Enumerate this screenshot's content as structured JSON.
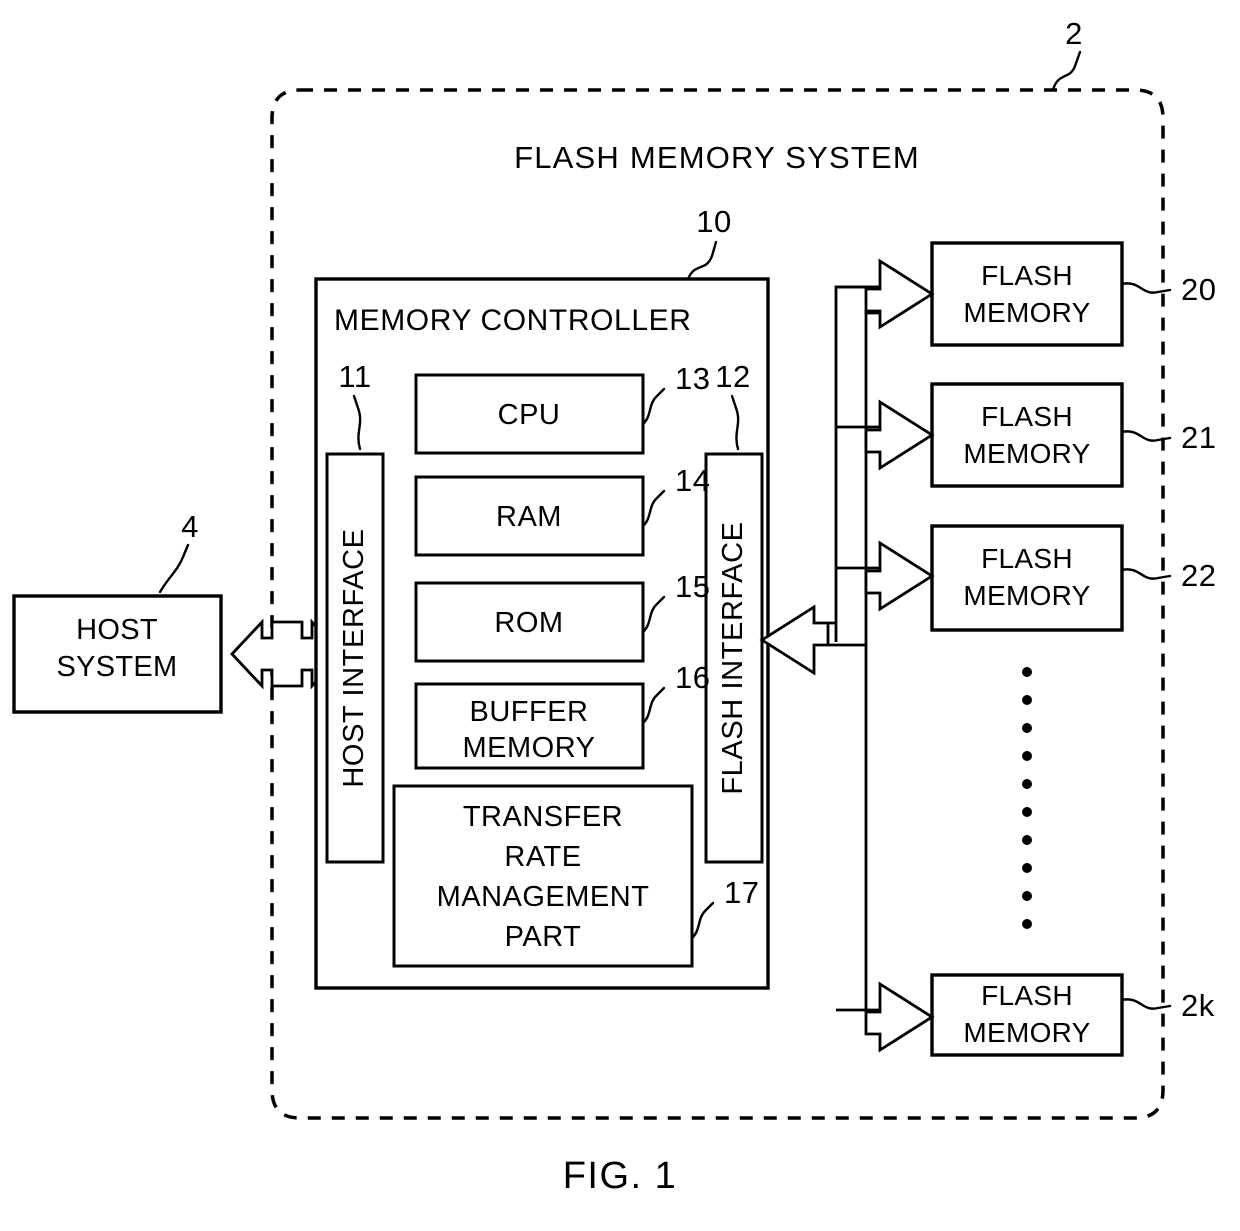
{
  "figure": {
    "caption": "FIG. 1",
    "system_title": "FLASH MEMORY SYSTEM",
    "system_ref": "2"
  },
  "host": {
    "label_line1": "HOST",
    "label_line2": "SYSTEM",
    "ref": "4"
  },
  "controller": {
    "title": "MEMORY CONTROLLER",
    "ref": "10",
    "host_interface": {
      "label": "HOST INTERFACE",
      "ref": "11"
    },
    "flash_interface": {
      "label": "FLASH INTERFACE",
      "ref": "12"
    },
    "blocks": [
      {
        "label": "CPU",
        "ref": "13"
      },
      {
        "label": "RAM",
        "ref": "14"
      },
      {
        "label": "ROM",
        "ref": "15"
      }
    ],
    "buffer": {
      "label_line1": "BUFFER",
      "label_line2": "MEMORY",
      "ref": "16"
    },
    "transfer_rate": {
      "label_line1": "TRANSFER",
      "label_line2": "RATE",
      "label_line3": "MANAGEMENT",
      "label_line4": "PART",
      "ref": "17"
    }
  },
  "flash_memories": [
    {
      "label_line1": "FLASH",
      "label_line2": "MEMORY",
      "ref": "20"
    },
    {
      "label_line1": "FLASH",
      "label_line2": "MEMORY",
      "ref": "21"
    },
    {
      "label_line1": "FLASH",
      "label_line2": "MEMORY",
      "ref": "22"
    },
    {
      "label_line1": "FLASH",
      "label_line2": "MEMORY",
      "ref": "2k"
    }
  ],
  "ellipsis": {
    "symbol": "vertical-dots",
    "count": 10
  },
  "colors": {
    "ink": "#000000",
    "paper": "#ffffff"
  }
}
